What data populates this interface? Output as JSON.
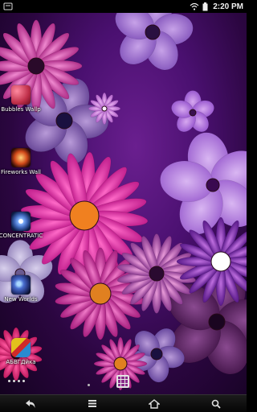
{
  "status_bar": {
    "time": "2:20 PM",
    "icons": [
      "notification-icon",
      "wifi-icon",
      "battery-icon"
    ]
  },
  "home_icons": [
    {
      "label": "Bubbles Wallp",
      "icon": "bubbles-wallpaper-icon",
      "color": "#c0304a"
    },
    {
      "label": "Fireworks Wall",
      "icon": "fireworks-wallpaper-icon",
      "color": "#d24a1a"
    },
    {
      "label": "CONCENTRATIC",
      "icon": "concentration-icon",
      "color": "#3a5fb0"
    },
    {
      "label": "New Worlds",
      "icon": "new-worlds-icon",
      "color": "#2a3d8a"
    },
    {
      "label": "АБВГДйка",
      "icon": "abvgdeyka-icon",
      "color": "#e2c21c"
    }
  ],
  "nav_bar": {
    "buttons": [
      "back-icon",
      "menu-icon",
      "home-icon",
      "search-icon"
    ]
  },
  "colors": {
    "wallpaper_base": "#4a1070",
    "status_bar": "#000000",
    "nav_bar": "#111111"
  }
}
